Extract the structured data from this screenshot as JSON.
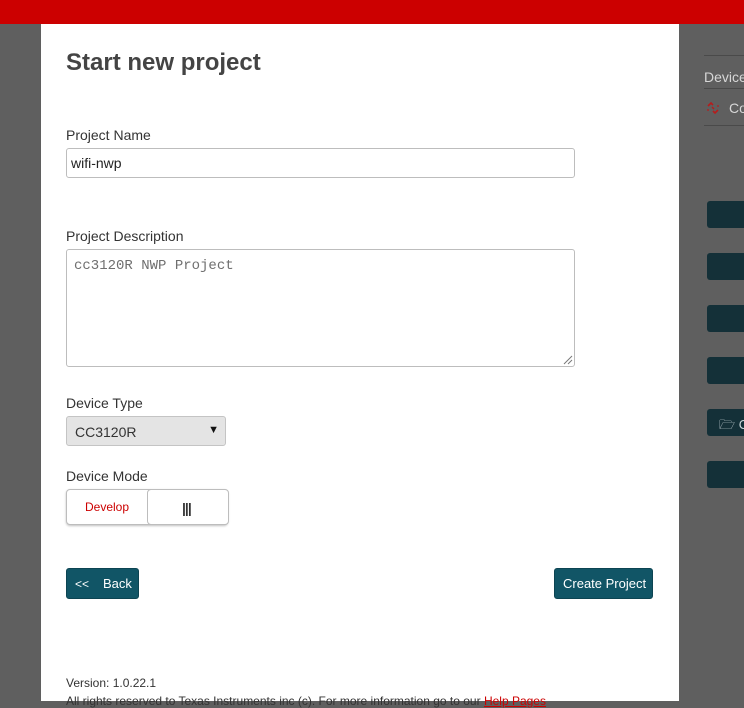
{
  "header": {
    "brand_color": "#cc0000"
  },
  "background": {
    "tabs": [
      "Device",
      "Co"
    ],
    "folder_button_label": "C",
    "link_icon": "broken-link-icon",
    "folder_icon": "folder-open-icon"
  },
  "modal": {
    "title": "Start new project",
    "project_name": {
      "label": "Project Name",
      "value": "wifi-nwp"
    },
    "project_description": {
      "label": "Project Description",
      "placeholder": "cc3120R NWP Project"
    },
    "device_type": {
      "label": "Device Type",
      "selected": "CC3120R"
    },
    "device_mode": {
      "label": "Device Mode",
      "option": "Develop",
      "handle_icon": "grip-lines-icon"
    },
    "buttons": {
      "back_chevron": "<<",
      "back": "Back",
      "create": "Create Project"
    },
    "footer": {
      "version": "Version: 1.0.22.1",
      "rights": "All rights reserved to Texas Instruments inc (c). For more information go to our ",
      "help_link": "Help Pages"
    }
  }
}
